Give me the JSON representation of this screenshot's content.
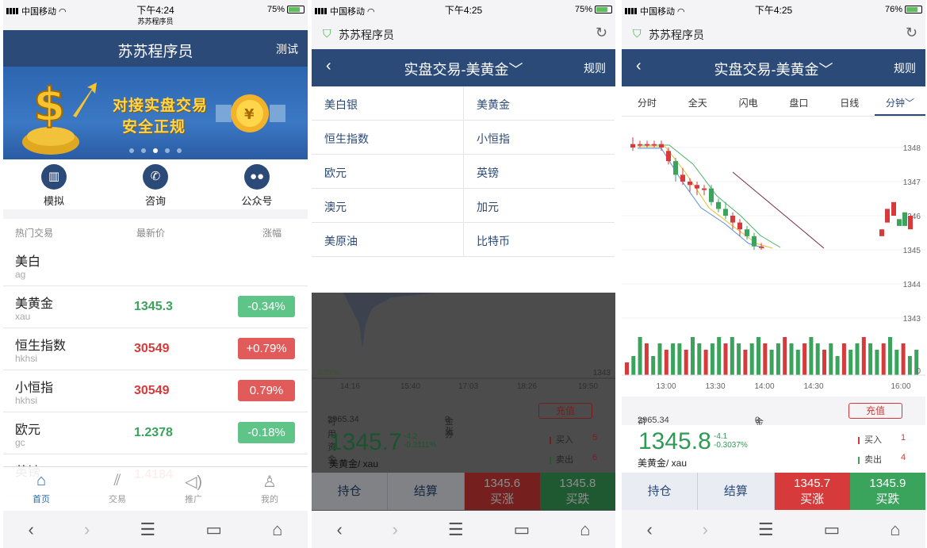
{
  "colors": {
    "navy": "#2b4a78",
    "up_red": "#d63a3a",
    "down_green": "#3aa35c",
    "accent_blue": "#2b6cb0"
  },
  "phone1": {
    "status": {
      "carrier": "中国移动",
      "time": "下午4:24",
      "sub": "苏苏程序员",
      "battery": "75%"
    },
    "header": {
      "title": "苏苏程序员",
      "action": "测试"
    },
    "banner": {
      "line1": "对接实盘交易",
      "line2": "安全正规",
      "slides": 5,
      "active_slide": 3
    },
    "shortcuts": [
      {
        "label": "模拟",
        "icon": "chart-icon"
      },
      {
        "label": "咨询",
        "icon": "phone-icon"
      },
      {
        "label": "公众号",
        "icon": "wechat-icon"
      }
    ],
    "table": {
      "headers": [
        "热门交易",
        "最新价",
        "涨幅"
      ],
      "rows": [
        {
          "name": "美白",
          "code": "ag",
          "price": "",
          "change": "",
          "dir": ""
        },
        {
          "name": "美黄金",
          "code": "xau",
          "price": "1345.3",
          "change": "-0.34%",
          "dir": "down"
        },
        {
          "name": "恒生指数",
          "code": "hkhsi",
          "price": "30549",
          "change": "+0.79%",
          "dir": "up"
        },
        {
          "name": "小恒指",
          "code": "hkhsi",
          "price": "30549",
          "change": "0.79%",
          "dir": "up"
        },
        {
          "name": "欧元",
          "code": "gc",
          "price": "1.2378",
          "change": "-0.18%",
          "dir": "down"
        },
        {
          "name": "英镑",
          "code": "",
          "price": "1.4184",
          "change": "",
          "dir": "up"
        }
      ]
    },
    "tabs": [
      {
        "label": "首页",
        "icon": "home-icon",
        "active": true
      },
      {
        "label": "交易",
        "icon": "trade-icon",
        "active": false
      },
      {
        "label": "推广",
        "icon": "speaker-icon",
        "active": false
      },
      {
        "label": "我的",
        "icon": "user-icon",
        "active": false
      }
    ]
  },
  "phone2": {
    "status": {
      "carrier": "中国移动",
      "time": "下午4:25",
      "battery": "75%"
    },
    "url_title": "苏苏程序员",
    "header": {
      "back": "‹",
      "title": "实盘交易-美黄金",
      "action": "规则"
    },
    "menu": [
      "美白银",
      "美黄金",
      "恒生指数",
      "小恒指",
      "欧元",
      "英镑",
      "澳元",
      "加元",
      "美原油",
      "比特币"
    ],
    "behind": {
      "pct": "-0.51%",
      "value": "1343",
      "times": [
        "14:16",
        "15:40",
        "17:03",
        "18:26",
        "19:50"
      ],
      "funds_label": "可用资金",
      "funds": "2965.34",
      "coupon_label": "金券",
      "coupon": "0 张",
      "charge": "充值",
      "price": "1345.7",
      "change": "-4.2",
      "change_pct": "-0.3111%",
      "symbol": "美黄金/ xau",
      "buy_label": "买入",
      "buy_qty": "5",
      "sell_label": "卖出",
      "sell_qty": "6",
      "hold": "持仓",
      "settle": "结算",
      "buy_price": "1345.6",
      "buy_btn": "买涨",
      "sell_price": "1345.8",
      "sell_btn": "买跌"
    }
  },
  "phone3": {
    "status": {
      "carrier": "中国移动",
      "time": "下午4:25",
      "battery": "76%"
    },
    "url_title": "苏苏程序员",
    "header": {
      "back": "‹",
      "title": "实盘交易-美黄金",
      "action": "规则"
    },
    "subtabs": [
      "分时",
      "全天",
      "闪电",
      "盘口",
      "日线",
      "分钟"
    ],
    "chart_data": {
      "type": "candlestick",
      "y_ticks": [
        "1348",
        "1347",
        "1346",
        "1345",
        "1344",
        "1343"
      ],
      "x_ticks": [
        "13:00",
        "13:30",
        "14:00",
        "14:30",
        "16:00"
      ],
      "volume_axis": "0",
      "candles": [
        {
          "o": 1348.0,
          "c": 1348.1,
          "h": 1348.3,
          "l": 1347.9,
          "up": false
        },
        {
          "o": 1348.1,
          "c": 1348.1,
          "h": 1348.2,
          "l": 1348.0,
          "up": false
        },
        {
          "o": 1348.1,
          "c": 1348.1,
          "h": 1348.2,
          "l": 1348.0,
          "up": false
        },
        {
          "o": 1348.1,
          "c": 1348.1,
          "h": 1348.2,
          "l": 1348.0,
          "up": false
        },
        {
          "o": 1348.1,
          "c": 1348.0,
          "h": 1348.2,
          "l": 1347.9,
          "up": false
        },
        {
          "o": 1347.9,
          "c": 1347.6,
          "h": 1348.0,
          "l": 1347.5,
          "up": false
        },
        {
          "o": 1347.6,
          "c": 1347.2,
          "h": 1347.7,
          "l": 1347.0,
          "up": true
        },
        {
          "o": 1347.2,
          "c": 1347.0,
          "h": 1347.4,
          "l": 1346.9,
          "up": false
        },
        {
          "o": 1347.0,
          "c": 1346.9,
          "h": 1347.1,
          "l": 1346.7,
          "up": false
        },
        {
          "o": 1346.9,
          "c": 1346.8,
          "h": 1347.0,
          "l": 1346.6,
          "up": false
        },
        {
          "o": 1346.8,
          "c": 1346.8,
          "h": 1346.9,
          "l": 1346.6,
          "up": false
        },
        {
          "o": 1346.8,
          "c": 1346.4,
          "h": 1346.9,
          "l": 1346.3,
          "up": true
        },
        {
          "o": 1346.4,
          "c": 1346.2,
          "h": 1346.5,
          "l": 1346.1,
          "up": true
        },
        {
          "o": 1346.2,
          "c": 1346.0,
          "h": 1346.4,
          "l": 1345.9,
          "up": true
        },
        {
          "o": 1346.0,
          "c": 1345.8,
          "h": 1346.1,
          "l": 1345.6,
          "up": false
        },
        {
          "o": 1345.8,
          "c": 1345.6,
          "h": 1345.9,
          "l": 1345.4,
          "up": false
        },
        {
          "o": 1345.6,
          "c": 1345.4,
          "h": 1345.7,
          "l": 1345.3,
          "up": true
        },
        {
          "o": 1345.4,
          "c": 1345.1,
          "h": 1345.5,
          "l": 1345.0,
          "up": true
        },
        {
          "o": 1345.1,
          "c": 1345.1,
          "h": 1345.2,
          "l": 1345.0,
          "up": false
        }
      ],
      "volumes": [
        2,
        3,
        6,
        5,
        3,
        5,
        4,
        5,
        5,
        4,
        6,
        5,
        4,
        5,
        6,
        5,
        6,
        5,
        4,
        5,
        6,
        5,
        4,
        5,
        6,
        5,
        4,
        5,
        6,
        5,
        4,
        5,
        3,
        5,
        4,
        5,
        6,
        5,
        4,
        5,
        6,
        4,
        5,
        3,
        4
      ]
    },
    "bottom": {
      "funds_label": "可用资金",
      "funds": "2965.34",
      "coupon_label": "金券",
      "coupon": "0 张",
      "charge": "充值",
      "price": "1345.8",
      "change": "-4.1",
      "change_pct": "-0.3037%",
      "symbol": "美黄金/ xau",
      "buy_label": "买入",
      "buy_qty": "1",
      "sell_label": "卖出",
      "sell_qty": "4",
      "hold": "持仓",
      "settle": "结算",
      "buy_price": "1345.7",
      "buy_btn": "买涨",
      "sell_price": "1345.9",
      "sell_btn": "买跌"
    }
  },
  "sysbar_icons": [
    "back-icon",
    "forward-icon",
    "menu-icon",
    "tabs-icon",
    "home-icon"
  ]
}
